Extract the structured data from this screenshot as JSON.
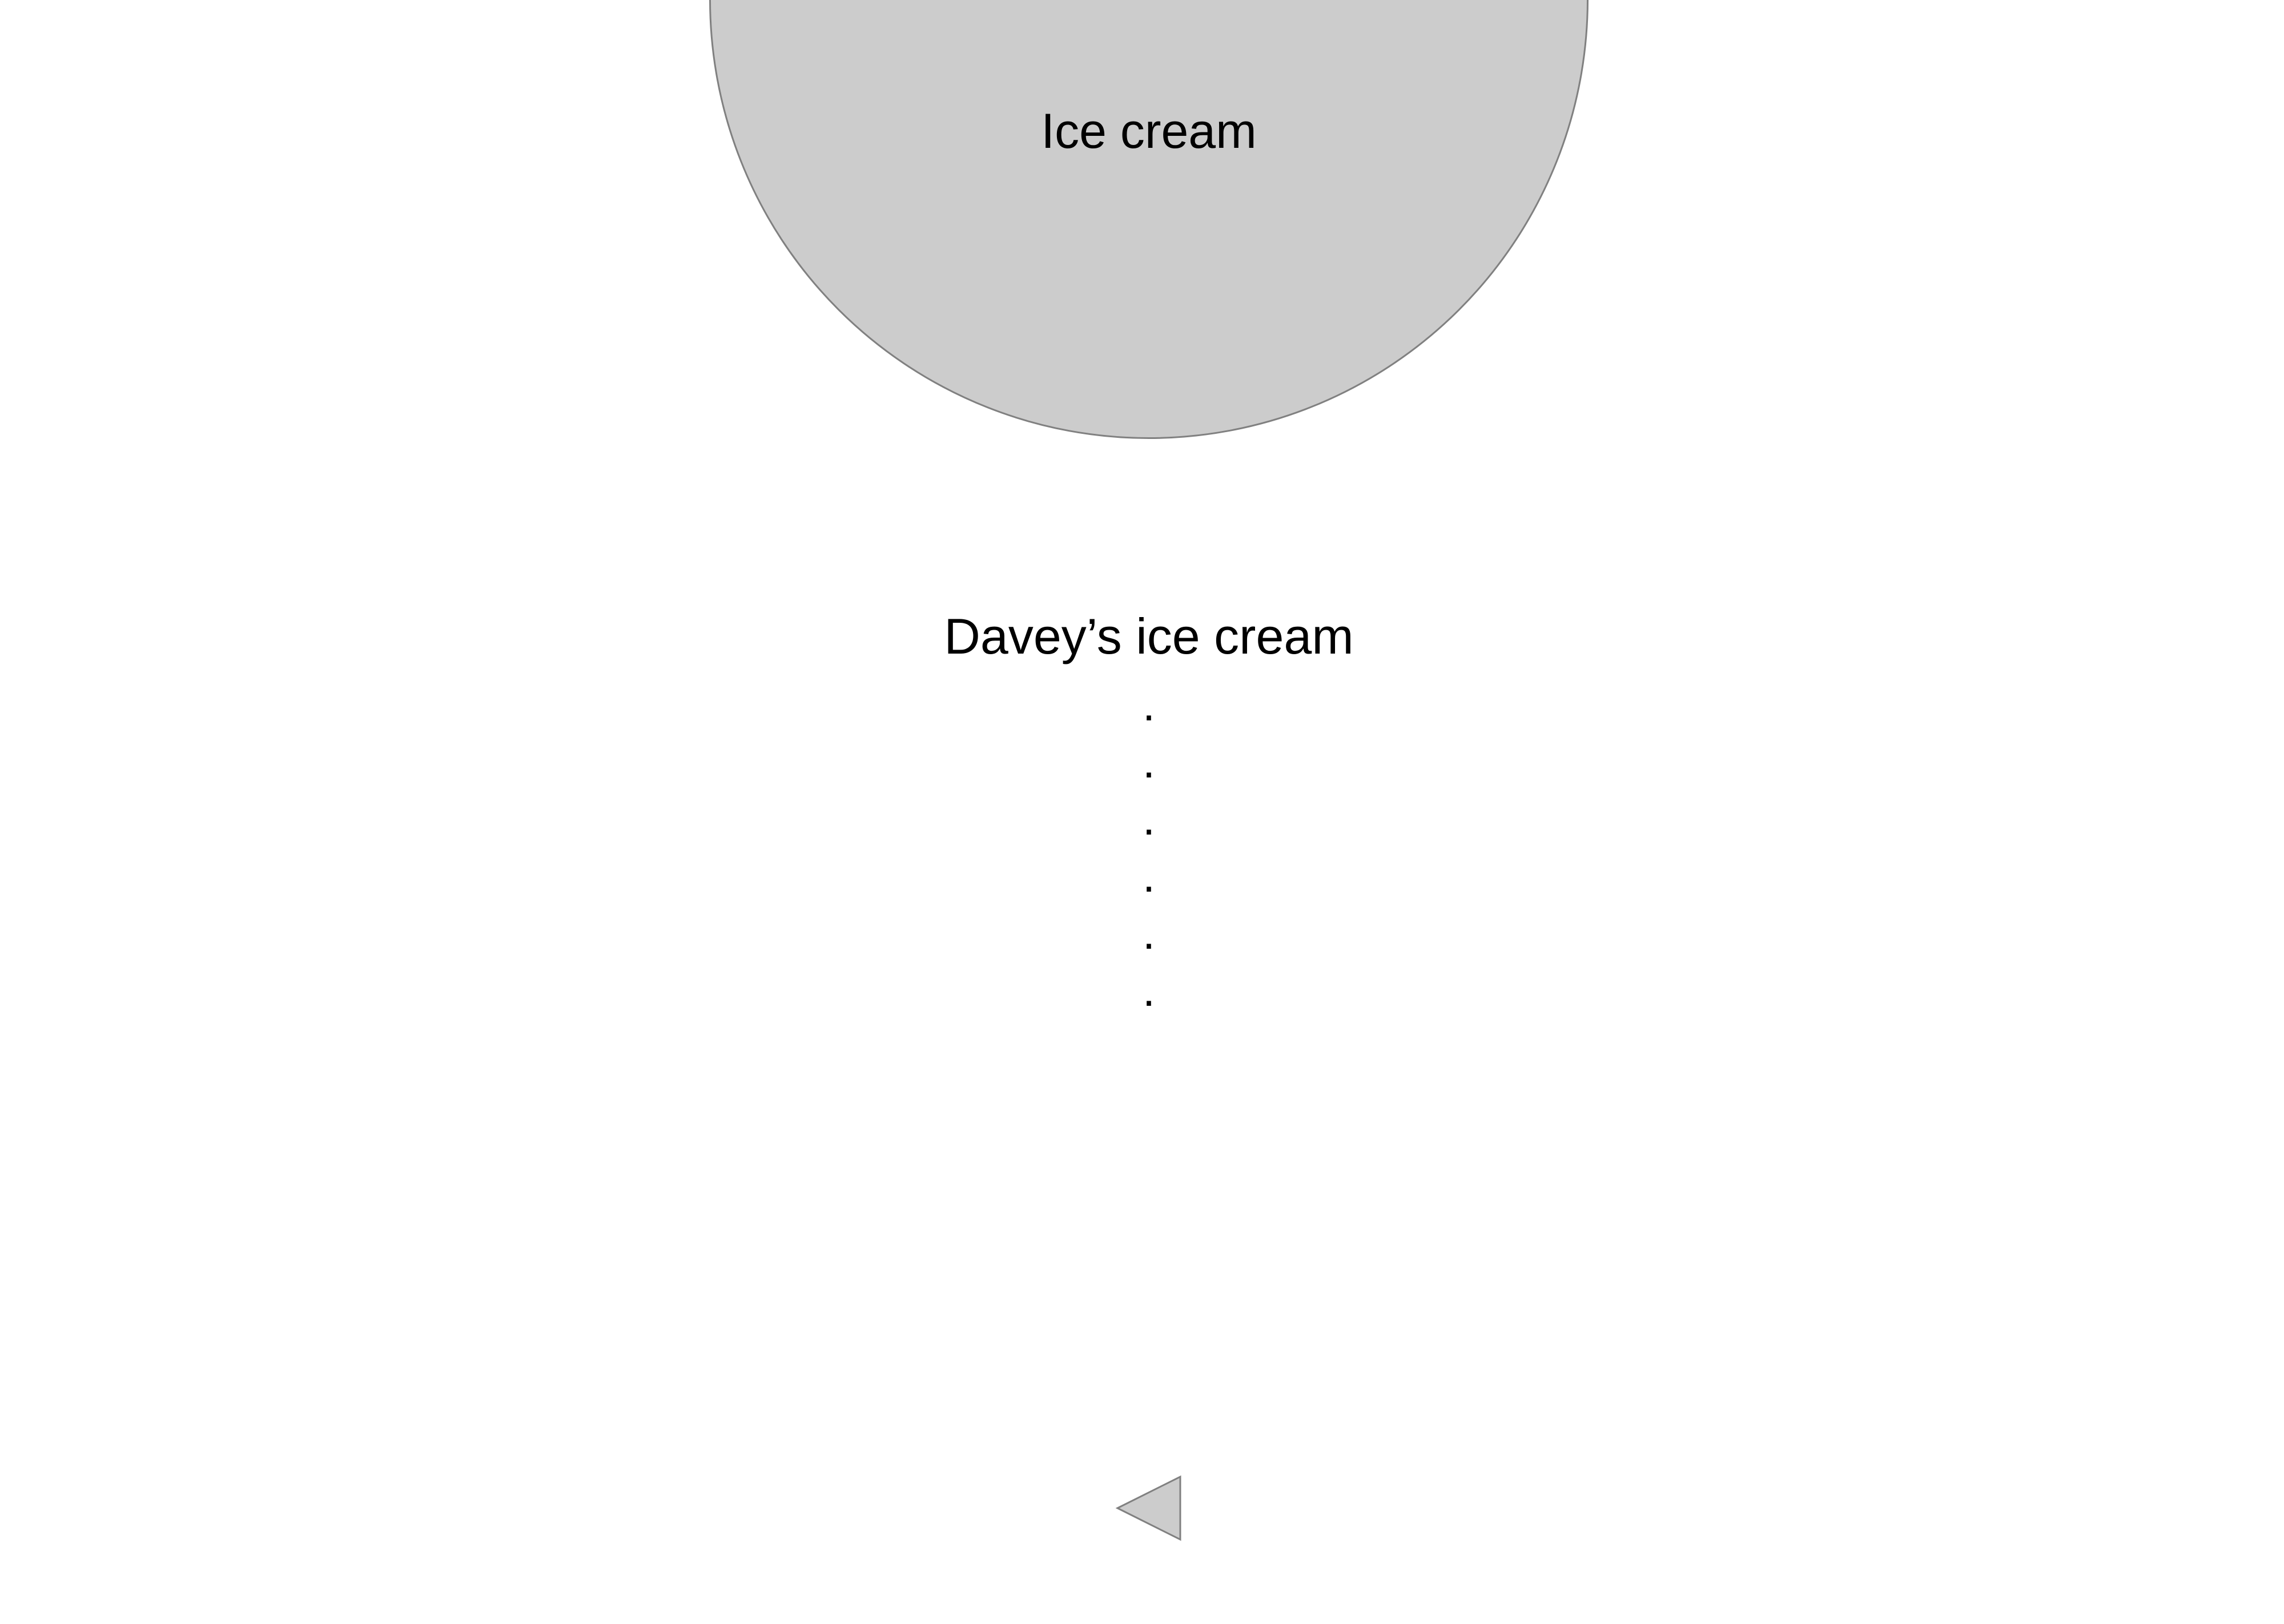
{
  "header": {
    "title": "Ice cream"
  },
  "shop": {
    "name": "Davey’s ice cream",
    "entries": [
      ".",
      ".",
      ".",
      ".",
      ".",
      "."
    ]
  },
  "controls": {
    "back_icon": "triangle-left-icon"
  },
  "colors": {
    "shape_fill": "#cccccc",
    "shape_stroke": "#808080",
    "text": "#000000",
    "background": "#ffffff"
  }
}
